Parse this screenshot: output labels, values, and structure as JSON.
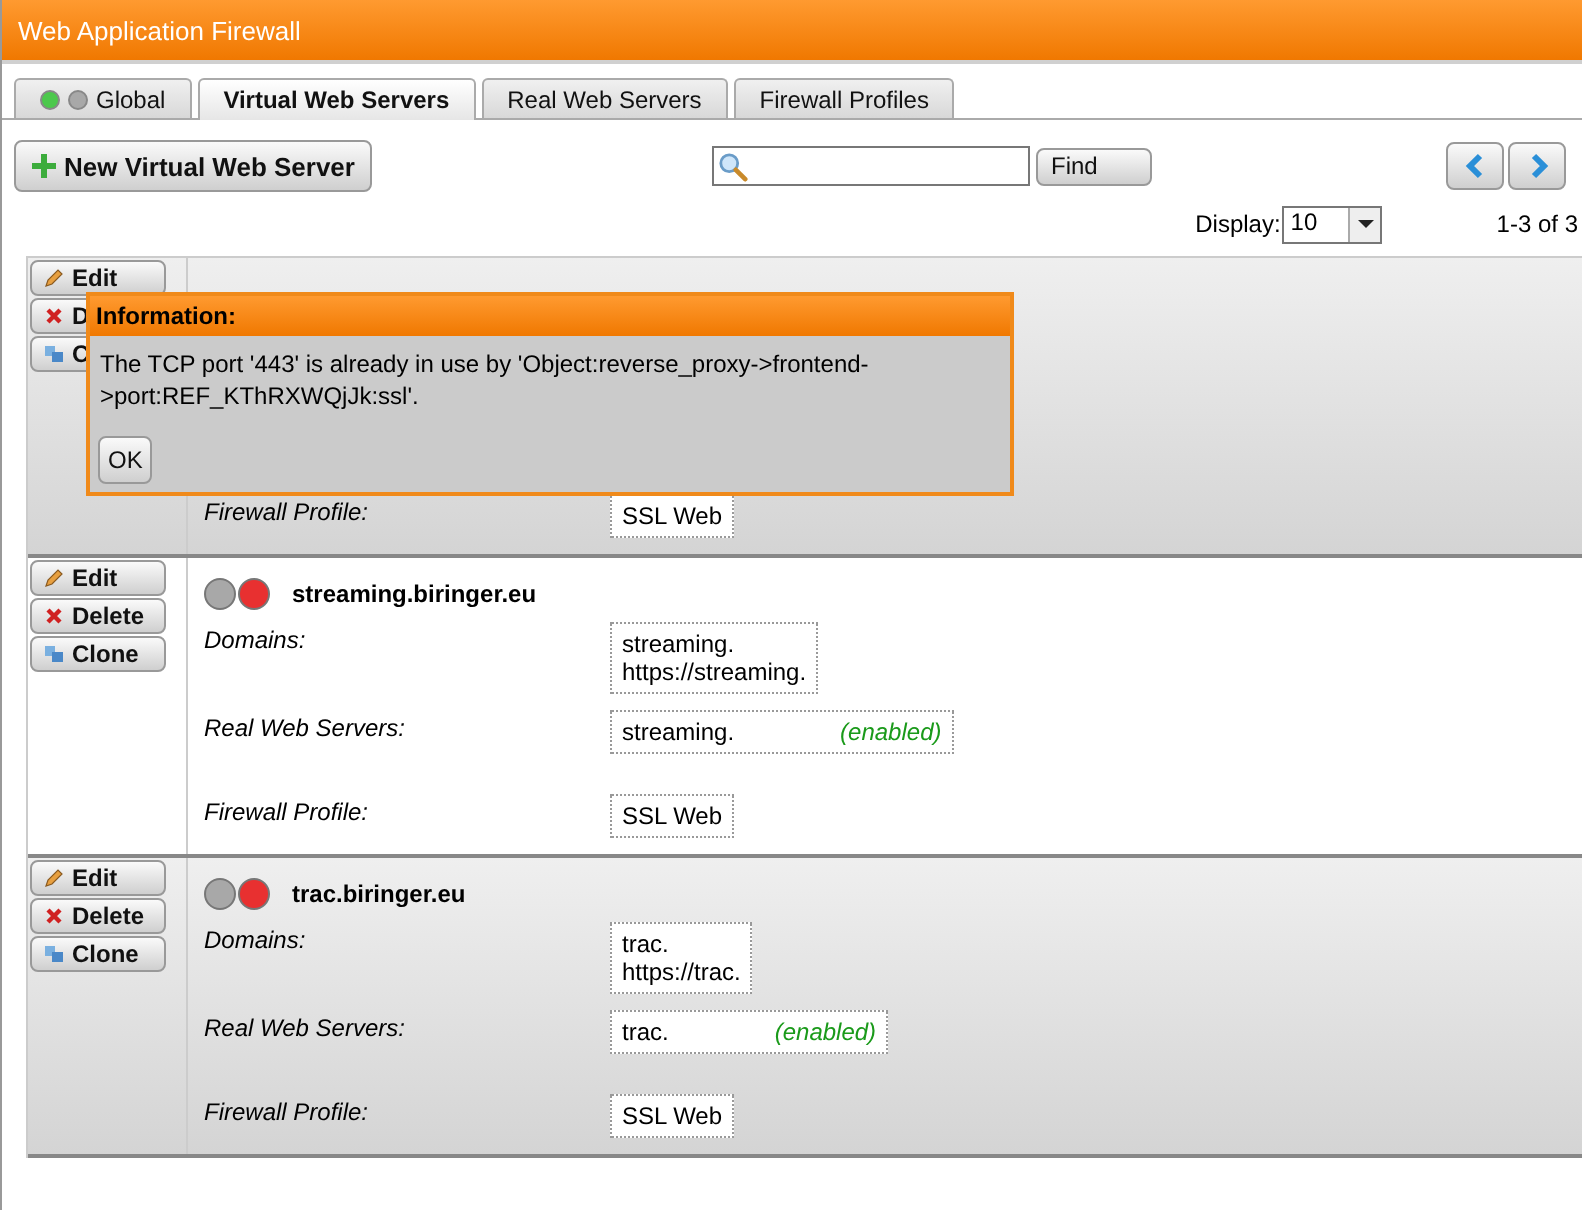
{
  "window": {
    "title": "Web Application Firewall"
  },
  "tabs": [
    {
      "label": "Global",
      "selected": false,
      "dots": [
        {
          "color": "#4cc84c"
        },
        {
          "color": "#a8a8a8"
        }
      ]
    },
    {
      "label": "Virtual Web Servers",
      "selected": true
    },
    {
      "label": "Real Web Servers",
      "selected": false
    },
    {
      "label": "Firewall Profiles",
      "selected": false
    }
  ],
  "toolbar": {
    "new_button": "New Virtual Web Server",
    "find_button": "Find"
  },
  "paging": {
    "display_label": "Display:",
    "display_value": "10",
    "range": "1-3 of 3"
  },
  "servers": [
    {
      "buttons": [
        "Edit",
        "D",
        "C"
      ],
      "fields": [
        {
          "label": "Firewall Profile:",
          "values": [
            {
              "text": "SSL Web"
            }
          ]
        }
      ]
    },
    {
      "buttons": [
        "Edit",
        "Delete",
        "Clone"
      ],
      "dots": [
        {
          "color": "#a8a8a8"
        },
        {
          "color": "#e83030"
        }
      ],
      "name": "streaming.biringer.eu",
      "fields": [
        {
          "label": "Domains:",
          "values": [
            {
              "text": "streaming."
            },
            {
              "text": "https://streaming."
            }
          ]
        },
        {
          "label": "Real Web Servers:",
          "values": [
            {
              "text": "streaming.",
              "status": "(enabled)"
            }
          ]
        },
        {
          "label": "Firewall Profile:",
          "values": [
            {
              "text": "SSL Web"
            }
          ]
        }
      ]
    },
    {
      "buttons": [
        "Edit",
        "Delete",
        "Clone"
      ],
      "dots": [
        {
          "color": "#a8a8a8"
        },
        {
          "color": "#e83030"
        }
      ],
      "name": "trac.biringer.eu",
      "fields": [
        {
          "label": "Domains:",
          "values": [
            {
              "text": "trac."
            },
            {
              "text": "https://trac."
            }
          ]
        },
        {
          "label": "Real Web Servers:",
          "values": [
            {
              "text": "trac.",
              "status": "(enabled)"
            }
          ]
        },
        {
          "label": "Firewall Profile:",
          "values": [
            {
              "text": "SSL Web"
            }
          ]
        }
      ]
    }
  ],
  "dialog": {
    "title": "Information:",
    "message": "The TCP port '443' is already in use by 'Object:reverse_proxy->frontend->port:REF_KThRXWQjJk:ssl'.",
    "button": "OK"
  }
}
